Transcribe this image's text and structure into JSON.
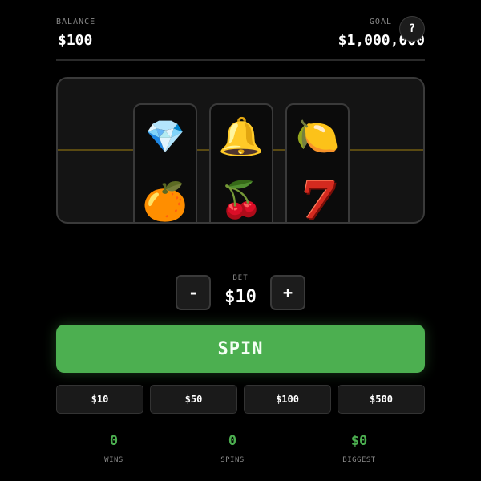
{
  "header": {
    "balance_label": "BALANCE",
    "balance_value": "$100",
    "goal_label": "GOAL",
    "goal_value": "$1,000,000",
    "help_label": "?"
  },
  "reels": [
    {
      "top": "💎",
      "bottom": "🍊",
      "top_name": "diamond-icon",
      "bottom_name": "orange-icon"
    },
    {
      "top": "🔔",
      "bottom": "🍒",
      "top_name": "bell-icon",
      "bottom_name": "cherries-icon"
    },
    {
      "top": "🍋",
      "bottom": "7",
      "top_name": "lemon-icon",
      "bottom_name": "seven-icon"
    }
  ],
  "bet": {
    "label": "BET",
    "value": "$10",
    "minus_label": "-",
    "plus_label": "+"
  },
  "spin": {
    "label": "SPIN"
  },
  "quick_bets": [
    "$10",
    "$50",
    "$100",
    "$500"
  ],
  "stats": {
    "wins": {
      "value": "0",
      "label": "WINS"
    },
    "spins": {
      "value": "0",
      "label": "SPINS"
    },
    "biggest": {
      "value": "$0",
      "label": "BIGGEST"
    }
  },
  "colors": {
    "accent": "#4caf50",
    "background": "#000000",
    "panel": "#141414",
    "payline": "#5a4a12"
  }
}
